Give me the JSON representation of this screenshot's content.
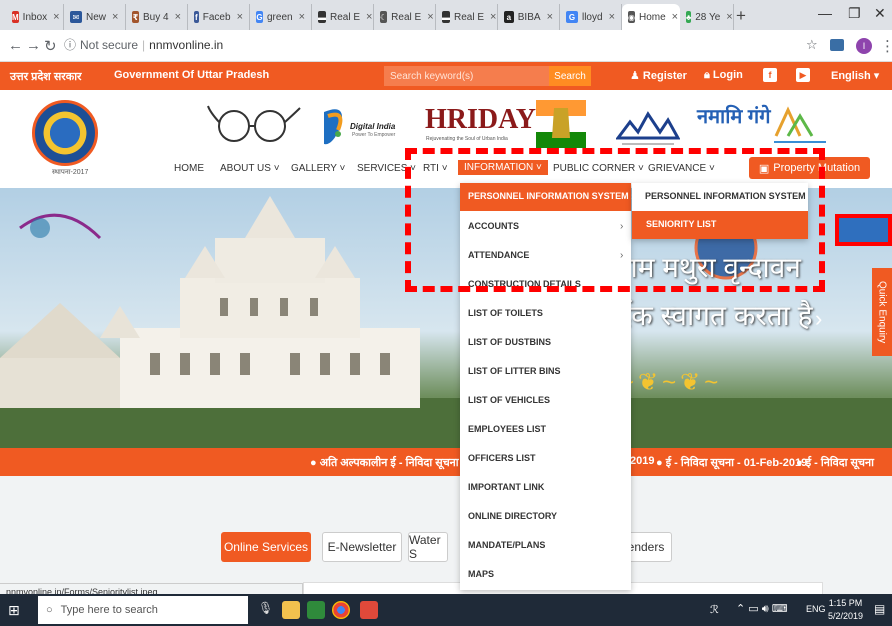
{
  "browser": {
    "tabs": [
      {
        "label": "Inbox",
        "icon": "gmail-icon",
        "color": "#d93025"
      },
      {
        "label": "New",
        "icon": "mail-icon",
        "color": "#2b579a"
      },
      {
        "label": "Buy 4",
        "icon": "shop-icon",
        "color": "#a2552d"
      },
      {
        "label": "Faceb",
        "icon": "facebook-icon",
        "color": "#3b5998"
      },
      {
        "label": "green",
        "icon": "google-icon",
        "color": "#4285f4"
      },
      {
        "label": "Real E",
        "icon": "page-icon",
        "color": "#333333"
      },
      {
        "label": "Real E",
        "icon": "moon-icon",
        "color": "#555555"
      },
      {
        "label": "Real E",
        "icon": "page-icon",
        "color": "#333333"
      },
      {
        "label": "BIBA",
        "icon": "amazon-icon",
        "color": "#222222"
      },
      {
        "label": "lloyd",
        "icon": "google-icon",
        "color": "#4285f4"
      },
      {
        "label": "Home",
        "icon": "globe-icon",
        "color": "#555555"
      },
      {
        "label": "28 Ye",
        "icon": "tree-icon",
        "color": "#34a853"
      }
    ],
    "active_tab_index": 10,
    "url_security": "Not secure",
    "url": "nnmvonline.in",
    "profile_initial": "I"
  },
  "topbar": {
    "state_hindi": "उत्तर प्रदेश सरकार",
    "state_english": "Government Of Uttar Pradesh",
    "search_placeholder": "Search keyword(s)",
    "search_button": "Search",
    "register": "Register",
    "login": "Login",
    "language": "English"
  },
  "header": {
    "emblem_year": "स्थापना-2017",
    "logos": [
      "swachh-bharat-logo",
      "digital-india-logo",
      "hriday-logo",
      "emblem-logo",
      "smart-city-logo",
      "namami-gange-logo",
      "scheme-logo"
    ],
    "digital_india": "Digital India",
    "digital_india_sub": "Power To Empower",
    "hriday": "HRIDAY",
    "hriday_sub": "Rejuvenating the Soul of Urban India",
    "namami": "नमामि गंगे",
    "nav": [
      "HOME",
      "ABOUT US",
      "GALLERY",
      "SERVICES",
      "RTI",
      "INFORMATION",
      "PUBLIC CORNER",
      "GRIEVANCE"
    ],
    "property_button": "Property Mutation"
  },
  "hero": {
    "line1": "र निगम मथुरा वृन्दावन",
    "line2": "हार्दिक स्वागत करता है",
    "quick_enquiry": "Quick Enquiry"
  },
  "ticker": {
    "items": [
      "● अति अल्पकालीन ई - निविदा सूचना",
      "2019",
      "● ई - निविदा सूचना - 01-Feb-2019",
      "● ई - निविदा सूचना"
    ]
  },
  "info_menu": {
    "items": [
      "PERSONNEL INFORMATION SYSTEM",
      "ACCOUNTS",
      "ATTENDANCE",
      "CONSTRUCTION DETAILS",
      "LIST OF TOILETS",
      "LIST OF DUSTBINS",
      "LIST OF LITTER BINS",
      "LIST OF VEHICLES",
      "EMPLOYEES LIST",
      "OFFICERS LIST",
      "IMPORTANT LINK",
      "ONLINE DIRECTORY",
      "MANDATE/PLANS",
      "MAPS"
    ],
    "selected_index": 0
  },
  "sub_menu": {
    "items": [
      "PERSONNEL INFORMATION SYSTEM",
      "SENIORITY LIST"
    ],
    "highlighted_index": 1
  },
  "content": {
    "tabs": [
      "Online Services",
      "E-Newsletter",
      "Water S",
      "enders"
    ]
  },
  "status_bar": "nnmvonline.in/Forms/Senioritylist.jpeg",
  "taskbar": {
    "search_placeholder": "Type here to search",
    "lang": "ENG",
    "time": "1:15 PM",
    "date": "5/2/2019"
  },
  "colors": {
    "accent": "#f05a22",
    "annotation": "#ff0000",
    "taskbar": "#1f2a38"
  }
}
